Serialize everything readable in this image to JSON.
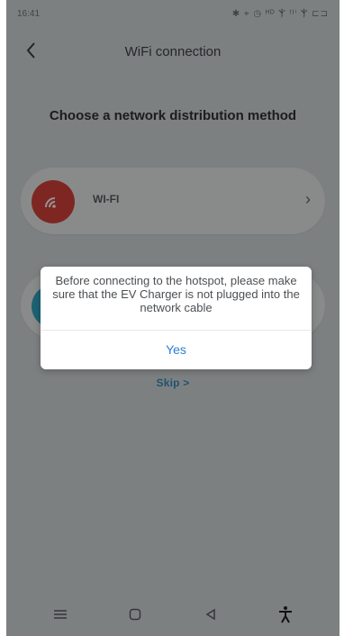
{
  "statusbar": {
    "time": "16:41",
    "icons_text": "✱ ⌖ ◷ ᴴᴰ Ⲯ ᵗᴵⁱ Ⲯ ⊏⊐"
  },
  "header": {
    "title": "WiFi connection",
    "back_icon": "chevron-left-icon"
  },
  "main": {
    "headline": "Choose a network distribution method",
    "options": [
      {
        "label": "WI-FI",
        "icon": "wifi-icon",
        "icon_color": "#d9443b"
      },
      {
        "label": "",
        "icon": "hotspot-icon",
        "icon_color": "#32a9c6"
      }
    ],
    "skip_label": "Skip  >"
  },
  "dialog": {
    "message": "Before connecting to the hotspot, please make sure that the EV Charger is not plugged into the network cable",
    "confirm_label": "Yes"
  },
  "navbar": {
    "icons": [
      "menu-icon",
      "home-icon",
      "back-triangle-icon",
      "accessibility-icon"
    ]
  }
}
